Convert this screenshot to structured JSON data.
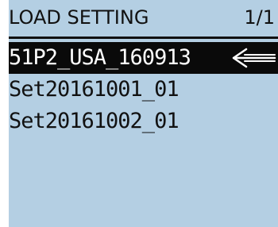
{
  "header": {
    "title": "LOAD SETTING",
    "page": "1/1"
  },
  "list": {
    "items": [
      {
        "label": "51P2_USA_160913",
        "selected": true
      },
      {
        "label": "Set20161001_01",
        "selected": false
      },
      {
        "label": "Set20161002_01",
        "selected": false
      }
    ]
  },
  "icons": {
    "selection_pointer": "left-arrow-icon"
  },
  "colors": {
    "screen_background": "#b4cfe3",
    "text": "#111111",
    "selected_row_background": "#0a0a0a",
    "selected_row_text": "#ffffff"
  }
}
